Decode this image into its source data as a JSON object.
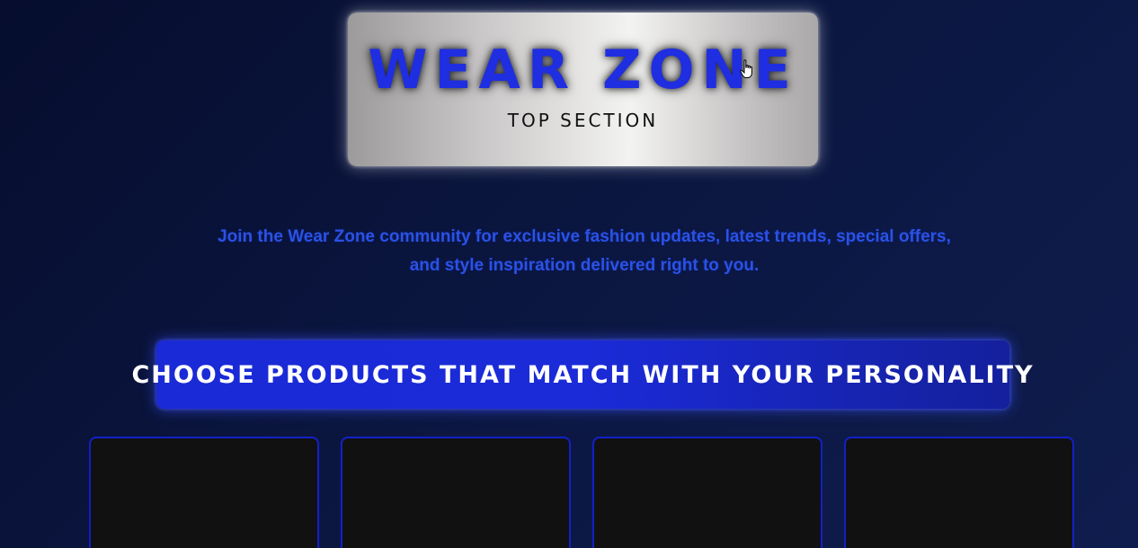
{
  "brand": {
    "title": "WEAR ZONE",
    "subtitle": "TOP SECTION"
  },
  "intro": {
    "text": "Join the Wear Zone community for exclusive fashion updates, latest trends, special offers, and style inspiration delivered right to you."
  },
  "cta": {
    "label": "CHOOSE PRODUCTS THAT MATCH WITH YOUR PERSONALITY"
  },
  "products": {
    "count_visible": 4
  },
  "colors": {
    "background": "#0b163f",
    "brand_blue": "#1f2ee0",
    "intro_text": "#2a52e6",
    "cta_background": "#1a2ad6",
    "card_background": "#111111",
    "card_border": "#1220c8"
  },
  "icons": {
    "cursor": "hand-pointer-icon"
  }
}
